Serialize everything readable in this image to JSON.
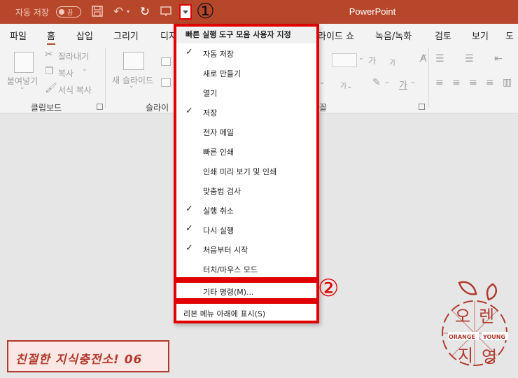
{
  "titlebar": {
    "autosave_label": "자동 저장",
    "autosave_toggle": "끔",
    "app_title": "PowerPoint",
    "annotation_1": "①"
  },
  "menu_tabs": [
    "파일",
    "홈",
    "삽입",
    "그리기",
    "디자",
    "라이드 쇼",
    "녹음/녹화",
    "검토",
    "보기",
    "도"
  ],
  "ribbon": {
    "paste_label": "붙여넣기",
    "cut_label": "잘라내기",
    "copy_label": "복사",
    "format_painter_label": "서식 복사",
    "new_slide_label": "새 슬라이드",
    "clipboard_group": "클립보드",
    "slides_group": "슬라이",
    "font_group": "꼴",
    "font_grow": "가",
    "font_shrink": "가",
    "font_color": "가"
  },
  "dropdown": {
    "header": "빠른 실행 도구 모음 사용자 지정",
    "items": [
      {
        "label": "자동 저장",
        "checked": true
      },
      {
        "label": "새로 만들기",
        "checked": false
      },
      {
        "label": "열기",
        "checked": false
      },
      {
        "label": "저장",
        "checked": true
      },
      {
        "label": "전자 메일",
        "checked": false
      },
      {
        "label": "빠른 인쇄",
        "checked": false
      },
      {
        "label": "인쇄 미리 보기 및 인쇄",
        "checked": false
      },
      {
        "label": "맞춤법 검사",
        "checked": false
      },
      {
        "label": "실행 취소",
        "checked": true
      },
      {
        "label": "다시 실행",
        "checked": true
      },
      {
        "label": "처음부터 시작",
        "checked": true
      },
      {
        "label": "터치/마우스 모드",
        "checked": false
      }
    ],
    "more_commands": "기타 명령(M)...",
    "show_below": "리본 메뉴 아래에 표시(S)",
    "check_glyph": "✓"
  },
  "annotation_2": "②",
  "banner_text": "친절한 지식충전소! 06",
  "logo": {
    "ko_o": "오",
    "ko_ren": "렌",
    "ko_ji": "지",
    "ko_young": "영",
    "en_orange": "ORANGE",
    "en_young": "YOUNG"
  },
  "colors": {
    "brand": "#b7472a",
    "highlight": "#e00000"
  }
}
